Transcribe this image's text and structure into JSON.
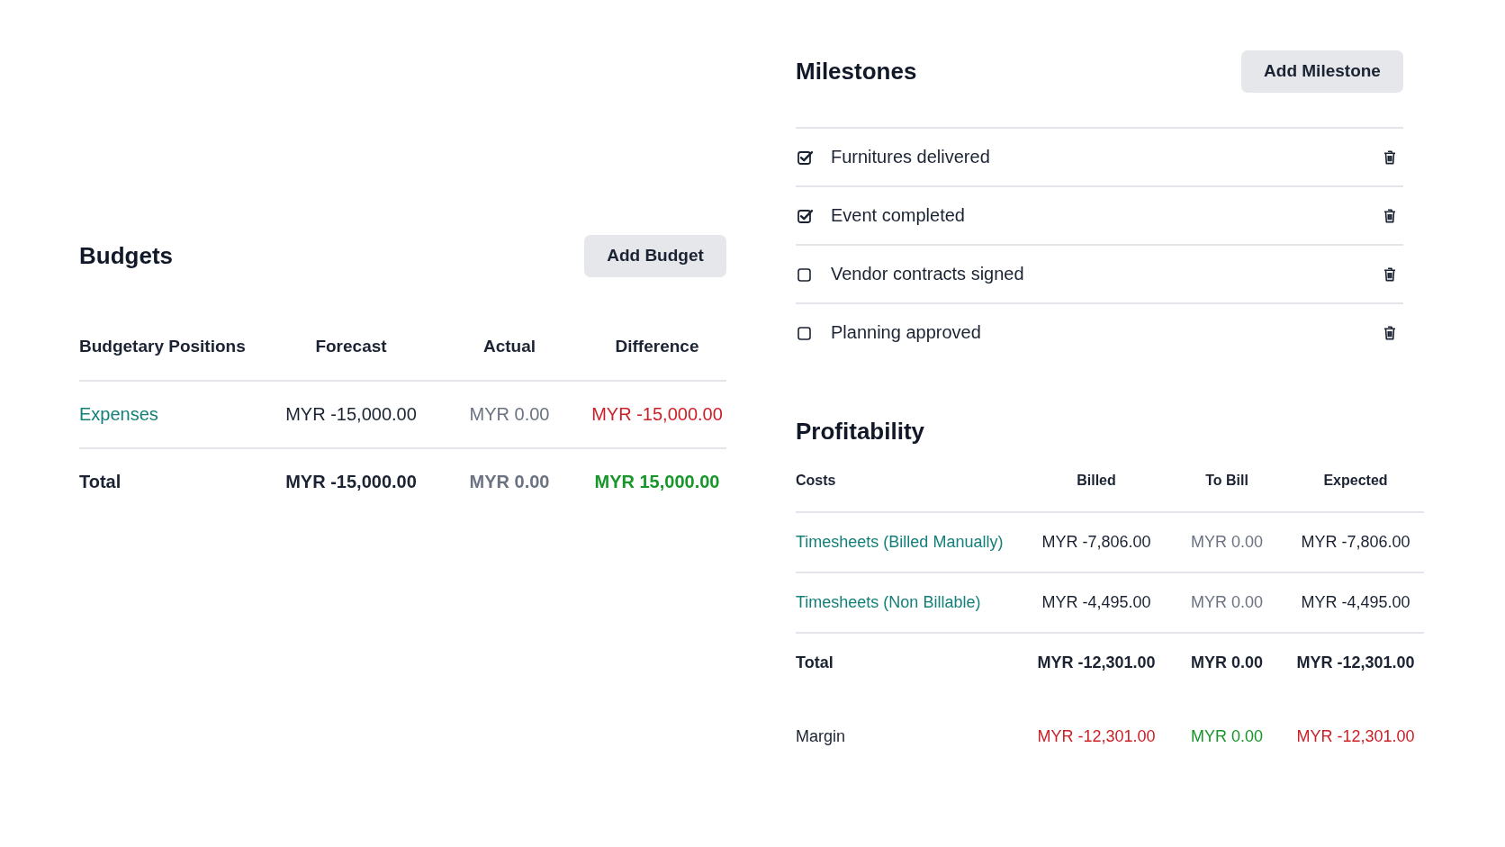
{
  "budgets": {
    "title": "Budgets",
    "add_button": "Add Budget",
    "columns": [
      "Budgetary Positions",
      "Forecast",
      "Actual",
      "Difference"
    ],
    "rows": [
      {
        "kind": "item",
        "cells": [
          {
            "text": "Expenses",
            "color": "#137f79"
          },
          {
            "text": "MYR -15,000.00",
            "color": "#1b2333"
          },
          {
            "text": "MYR 0.00",
            "color": "#6b7280"
          },
          {
            "text": "MYR -15,000.00",
            "color": "#cc1f26"
          }
        ]
      },
      {
        "kind": "total",
        "cells": [
          {
            "text": "Total",
            "color": "#1b2333"
          },
          {
            "text": "MYR -15,000.00",
            "color": "#1b2333"
          },
          {
            "text": "MYR 0.00",
            "color": "#6b7280"
          },
          {
            "text": "MYR 15,000.00",
            "color": "#17962a"
          }
        ]
      }
    ]
  },
  "milestones": {
    "title": "Milestones",
    "add_button": "Add Milestone",
    "items": [
      {
        "label": "Furnitures delivered",
        "checked": true
      },
      {
        "label": "Event completed",
        "checked": true
      },
      {
        "label": "Vendor contracts signed",
        "checked": false
      },
      {
        "label": "Planning approved",
        "checked": false
      }
    ]
  },
  "profitability": {
    "title": "Profitability",
    "columns": [
      "Costs",
      "Billed",
      "To Bill",
      "Expected"
    ],
    "rows": [
      {
        "kind": "item",
        "cells": [
          {
            "text": "Timesheets (Billed Manually)",
            "color": "#137f79"
          },
          {
            "text": "MYR -7,806.00",
            "color": "#1b2333"
          },
          {
            "text": "MYR 0.00",
            "color": "#6b7280"
          },
          {
            "text": "MYR -7,806.00",
            "color": "#1b2333"
          }
        ]
      },
      {
        "kind": "item",
        "cells": [
          {
            "text": "Timesheets (Non Billable)",
            "color": "#137f79"
          },
          {
            "text": "MYR -4,495.00",
            "color": "#1b2333"
          },
          {
            "text": "MYR 0.00",
            "color": "#6b7280"
          },
          {
            "text": "MYR -4,495.00",
            "color": "#1b2333"
          }
        ]
      },
      {
        "kind": "total",
        "cells": [
          {
            "text": "Total",
            "color": "#1b2333"
          },
          {
            "text": "MYR -12,301.00",
            "color": "#1b2333"
          },
          {
            "text": "MYR 0.00",
            "color": "#1b2333"
          },
          {
            "text": "MYR -12,301.00",
            "color": "#1b2333"
          }
        ]
      },
      {
        "kind": "margin",
        "cells": [
          {
            "text": "Margin",
            "color": "#1b2333"
          },
          {
            "text": "MYR -12,301.00",
            "color": "#cc1f26"
          },
          {
            "text": "MYR 0.00",
            "color": "#17962a"
          },
          {
            "text": "MYR -12,301.00",
            "color": "#cc1f26"
          }
        ]
      }
    ]
  }
}
